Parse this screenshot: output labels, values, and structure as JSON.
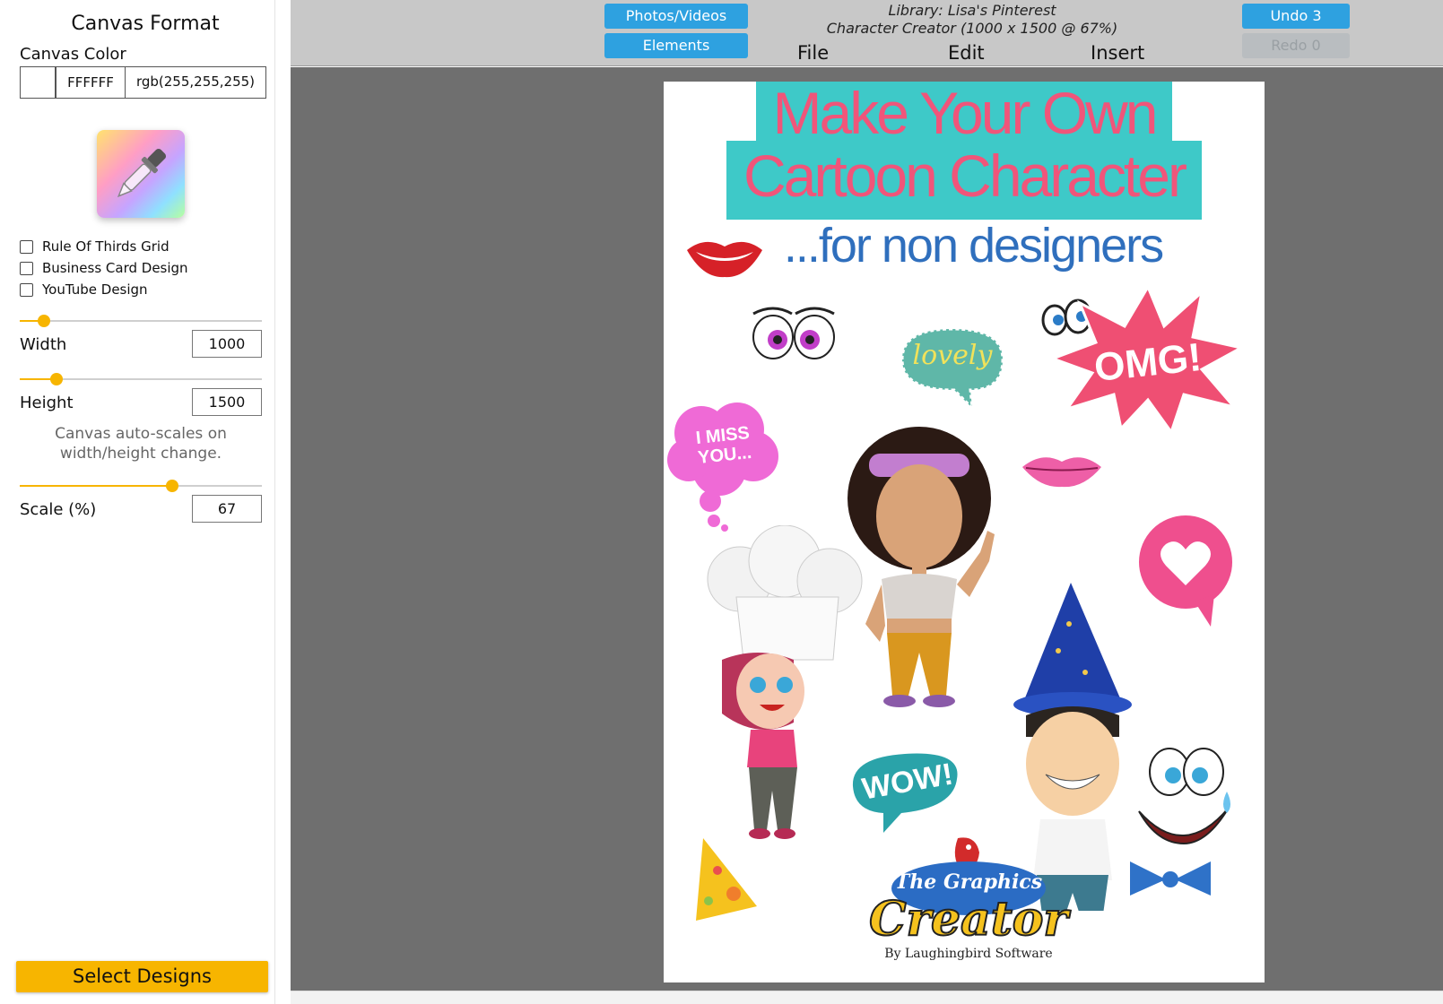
{
  "left_panel": {
    "title": "Canvas Format",
    "canvas_color_label": "Canvas Color",
    "hex_value": "FFFFFF",
    "rgb_value": "rgb(255,255,255)",
    "swatch_color": "#FFFFFF",
    "options": [
      {
        "label": "Rule Of Thirds Grid",
        "checked": false
      },
      {
        "label": "Business Card Design",
        "checked": false
      },
      {
        "label": "YouTube Design",
        "checked": false
      }
    ],
    "width_label": "Width",
    "width_value": "1000",
    "height_label": "Height",
    "height_value": "1500",
    "hint": "Canvas auto-scales on width/height change.",
    "scale_label": "Scale (%)",
    "scale_value": "67",
    "sliders": {
      "width_level": 0.1,
      "height_level": 0.15,
      "scale_level": 0.63
    },
    "select_designs": "Select Designs"
  },
  "topbar": {
    "photos_videos": "Photos/Videos",
    "elements": "Elements",
    "library_line": "Library: Lisa's Pinterest",
    "project_line": "Character Creator  (1000 x 1500 @ 67%)",
    "menu": [
      "File",
      "Edit",
      "Insert"
    ],
    "undo": "Undo 3",
    "redo": "Redo 0"
  },
  "design": {
    "title_line1": "Make Your Own",
    "title_line2": "Cartoon Character",
    "subtitle": "...for non designers",
    "stickers": {
      "lovely": "lovely",
      "omg": "OMG!",
      "miss_you_1": "I MISS",
      "miss_you_2": "YOU...",
      "wow": "WOW!"
    },
    "logo_line1": "The",
    "logo_line2": "Graphics",
    "logo_line3": "Creator",
    "logo_byline": "By Laughingbird Software"
  },
  "colors": {
    "accent_blue": "#2EA1E0",
    "accent_yellow": "#F7B500",
    "title_pink": "#F0557A",
    "title_band": "#3EC9C8",
    "subtitle_blue": "#2F6FBD",
    "workspace_gray": "#6F6F6F"
  }
}
